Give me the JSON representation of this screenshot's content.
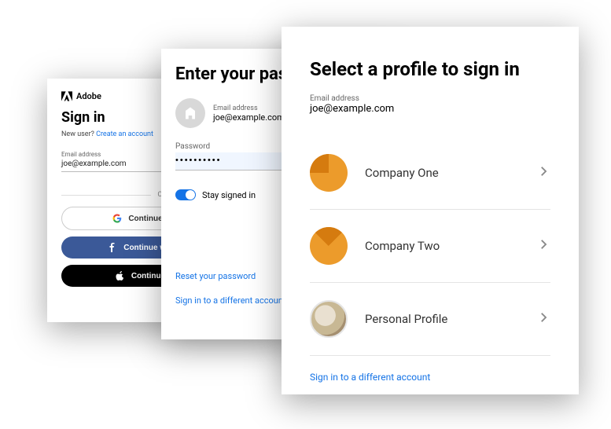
{
  "card1": {
    "brand": "Adobe",
    "title": "Sign in",
    "new_user_text": "New user? ",
    "create_account": "Create an account",
    "email_label": "Email address",
    "email_value": "joe@example.com",
    "or": "Or",
    "google": "Continue with Google",
    "facebook": "Continue with Facebook",
    "apple": "Continue with Apple"
  },
  "card2": {
    "title": "Enter your password",
    "email_label": "Email address",
    "email_value": "joe@example.com",
    "password_label": "Password",
    "password_value": "••••••••••",
    "stay_signed_in": "Stay signed in",
    "stay_signed_in_checked": true,
    "reset_link": "Reset your password",
    "diff_account_link": "Sign in to a different account"
  },
  "card3": {
    "title": "Select a profile to sign in",
    "email_label": "Email address",
    "email_value": "joe@example.com",
    "profiles": [
      {
        "name": "Company One",
        "type": "company"
      },
      {
        "name": "Company Two",
        "type": "company"
      },
      {
        "name": "Personal Profile",
        "type": "personal"
      }
    ],
    "diff_account_link": "Sign in to a different account"
  }
}
